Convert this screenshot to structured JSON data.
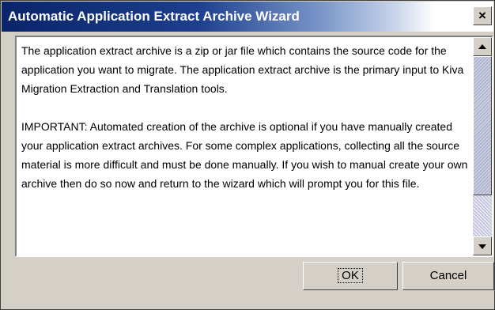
{
  "dialog": {
    "title": "Automatic Application Extract Archive Wizard",
    "close_glyph": "×",
    "paragraphs": [
      "The application extract archive is a zip or jar file which contains the source code for the application you want to migrate. The application extract archive is the primary input to Kiva Migration Extraction and Translation tools.",
      "IMPORTANT: Automated creation of the archive is optional if you have manually created your application extract archives.  For some complex applications, collecting all the source material is more difficult and must be done manually.  If you wish to manual create your own archive then do so now and return to the wizard which will prompt you for this file."
    ],
    "buttons": {
      "ok": "OK",
      "cancel": "Cancel"
    }
  },
  "scrollbar": {
    "position": 0.0
  },
  "colors": {
    "titlebar_start": "#0a246a",
    "titlebar_end": "#ffffff",
    "dialog_face": "#d4d0c8",
    "content_bg": "#ffffff"
  },
  "icons": {
    "close": "close-icon",
    "scroll_up": "arrow-up-icon",
    "scroll_down": "arrow-down-icon"
  }
}
